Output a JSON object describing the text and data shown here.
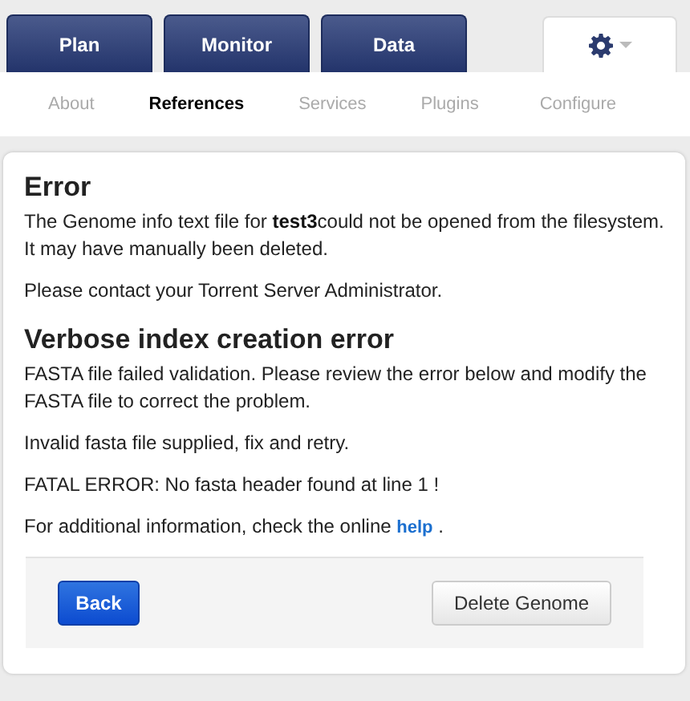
{
  "main_tabs": [
    {
      "label": "Plan"
    },
    {
      "label": "Monitor"
    },
    {
      "label": "Data"
    }
  ],
  "subnav": [
    {
      "label": "About",
      "selected": false
    },
    {
      "label": "References",
      "selected": true
    },
    {
      "label": "Services",
      "selected": false
    },
    {
      "label": "Plugins",
      "selected": false
    },
    {
      "label": "Configure",
      "selected": false
    }
  ],
  "sections": [
    {
      "heading": "Error",
      "paragraphs": [
        "The Genome info text file for **test3**could not be opened from the filesystem. It may have manually been deleted.",
        "Please contact your Torrent Server Administrator."
      ]
    },
    {
      "heading": "Verbose index creation error",
      "paragraphs": [
        "FASTA file failed validation. Please review the error below and modify the FASTA file to correct the problem.",
        "Invalid fasta file supplied, fix and retry.",
        "FATAL ERROR: No fasta header found at line 1 !"
      ]
    }
  ],
  "help_note": {
    "before": "For additional information, check the online ",
    "link": "help",
    "after": " ."
  },
  "buttons": [
    {
      "label": "Back",
      "kind": "primary"
    },
    {
      "label": "Delete Genome",
      "kind": "default"
    }
  ]
}
